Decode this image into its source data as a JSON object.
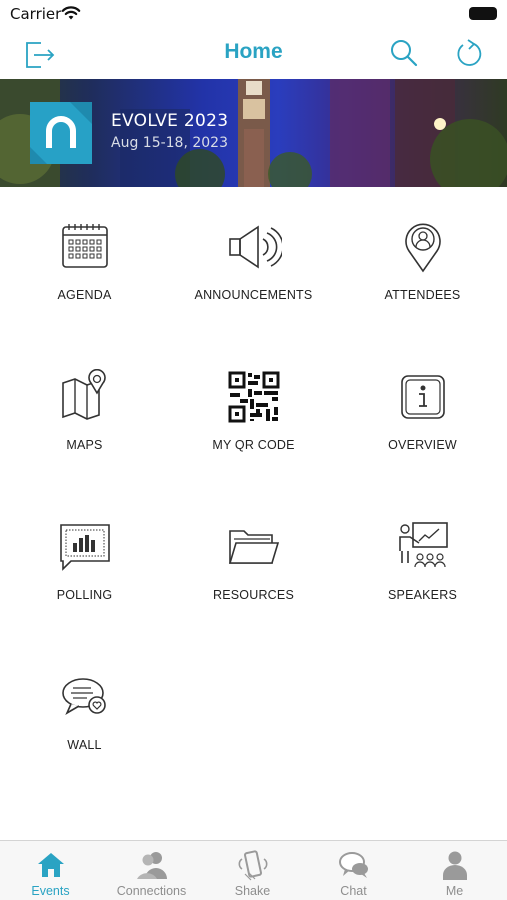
{
  "status_bar": {
    "carrier": "Carrier"
  },
  "nav": {
    "title": "Home"
  },
  "banner": {
    "event_name": "EVOLVE 2023",
    "event_dates": "Aug 15-18, 2023"
  },
  "tiles": [
    {
      "label": "AGENDA",
      "icon": "calendar-icon"
    },
    {
      "label": "ANNOUNCEMENTS",
      "icon": "megaphone-icon"
    },
    {
      "label": "ATTENDEES",
      "icon": "person-pin-icon"
    },
    {
      "label": "MAPS",
      "icon": "map-icon"
    },
    {
      "label": "MY QR CODE",
      "icon": "qr-code-icon"
    },
    {
      "label": "OVERVIEW",
      "icon": "info-icon"
    },
    {
      "label": "POLLING",
      "icon": "poll-chart-icon"
    },
    {
      "label": "RESOURCES",
      "icon": "folder-icon"
    },
    {
      "label": "SPEAKERS",
      "icon": "presenter-icon"
    },
    {
      "label": "WALL",
      "icon": "chat-bubbles-icon"
    }
  ],
  "tabs": [
    {
      "label": "Events",
      "icon": "home-icon",
      "active": true
    },
    {
      "label": "Connections",
      "icon": "people-icon",
      "active": false
    },
    {
      "label": "Shake",
      "icon": "phone-shake-icon",
      "active": false
    },
    {
      "label": "Chat",
      "icon": "chat-icon",
      "active": false
    },
    {
      "label": "Me",
      "icon": "person-icon",
      "active": false
    }
  ],
  "colors": {
    "accent": "#2aa3c3",
    "inactive_tab": "#8e8e8e",
    "tab_bar_bg": "#f7f7f7",
    "logo_bg": "#27a1c6"
  }
}
